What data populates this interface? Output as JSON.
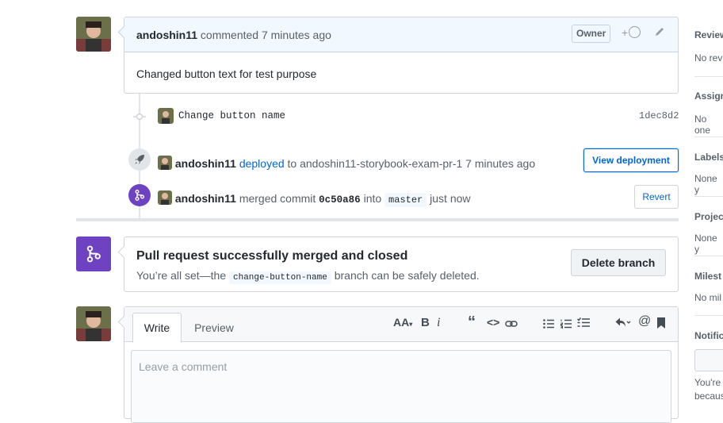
{
  "comment": {
    "author": "andoshin11",
    "meta": "commented 7 minutes ago",
    "role_badge": "Owner",
    "body": "Changed button text for test purpose"
  },
  "commit": {
    "message": "Change button name",
    "sha": "1dec8d2"
  },
  "deploy_event": {
    "actor": "andoshin11",
    "action": "deployed",
    "rest": "to andoshin11-storybook-exam-pr-1 7 minutes ago",
    "button": "View deployment"
  },
  "merge_event": {
    "actor": "andoshin11",
    "merged_text": "merged commit",
    "commit_sha": "0c50a86",
    "into_text": "into",
    "branch": "master",
    "time": "just now",
    "button": "Revert"
  },
  "merged_box": {
    "title": "Pull request successfully merged and closed",
    "prefix": "You’re all set—the",
    "branch": "change-button-name",
    "suffix": "branch can be safely deleted.",
    "button": "Delete branch"
  },
  "editor": {
    "tab_write": "Write",
    "tab_preview": "Preview",
    "placeholder": "Leave a comment",
    "toolbar_icons": [
      "text-size-icon",
      "bold-icon",
      "italic-icon",
      "quote-icon",
      "code-icon",
      "link-icon",
      "bullet-list-icon",
      "numbered-list-icon",
      "task-list-icon",
      "reply-icon",
      "mention-icon",
      "bookmark-icon"
    ]
  },
  "sidebar": {
    "reviewers": {
      "title": "Review",
      "value": "No rev"
    },
    "assignees": {
      "title": "Assign",
      "value": "No one"
    },
    "labels": {
      "title": "Labels",
      "value": "None y"
    },
    "projects": {
      "title": "Projec",
      "value": "None y"
    },
    "milestone": {
      "title": "Milest",
      "value": "No mil"
    },
    "notifications": {
      "title": "Notific",
      "line1": "You're",
      "line2": "becaus"
    }
  },
  "colors": {
    "link": "#0366d6",
    "merged_purple": "#6f42c1",
    "comment_header_bg": "#f1f8ff"
  }
}
